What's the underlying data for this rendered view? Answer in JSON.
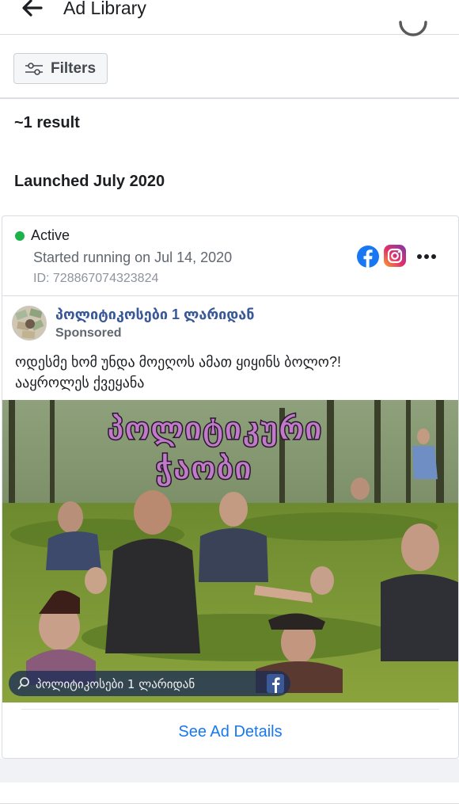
{
  "header": {
    "title": "Ad Library",
    "back_icon": "arrow-left-icon"
  },
  "filters": {
    "label": "Filters",
    "icon": "sliders-icon"
  },
  "results": {
    "count_text": "~1 result",
    "section_heading": "Launched July 2020"
  },
  "ad": {
    "status": "Active",
    "status_color": "#1bb34a",
    "started": "Started running on Jul 14, 2020",
    "id_text": "ID: 728867074323824",
    "platforms": [
      "facebook-icon",
      "instagram-icon"
    ],
    "page_name": "პოლიტიკოსები 1 ლარიდან",
    "sponsored": "Sponsored",
    "body_line1": "ოდესმე ხომ უნდა მოეღოს ამათ ყიყინს ბოლო?!",
    "body_line2": "ააყროლეს ქვეყანა",
    "image": {
      "title_line1": "პოლიტიკური",
      "title_line2": "ჭაობი",
      "watermark": "პოლიტიკოსები 1 ლარიდან"
    },
    "details_link": "See Ad Details"
  },
  "colors": {
    "link": "#1877f2",
    "page_name": "#385898",
    "facebook": "#1877f2"
  }
}
